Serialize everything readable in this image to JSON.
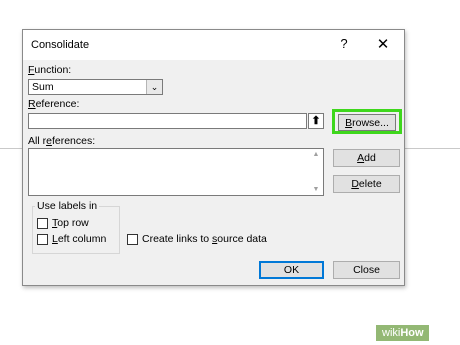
{
  "dialog": {
    "title": "Consolidate",
    "help_label": "?",
    "close_label": "✕",
    "function": {
      "label_pre": "",
      "label_underlined": "F",
      "label_post": "unction:",
      "value": "Sum"
    },
    "reference": {
      "label_underlined": "R",
      "label_post": "eference:",
      "value": "",
      "collapse_icon": "collapse-arrow-icon"
    },
    "browse_button": {
      "underlined": "B",
      "rest": "rowse..."
    },
    "all_references": {
      "pre": "All r",
      "underlined": "e",
      "post": "ferences:"
    },
    "add_button": {
      "underlined": "A",
      "rest": "dd"
    },
    "delete_button": {
      "underlined": "D",
      "rest": "elete"
    },
    "use_labels": {
      "legend": "Use labels in",
      "top_row": {
        "underlined": "T",
        "rest": "op row",
        "checked": false
      },
      "left_column": {
        "underlined": "L",
        "rest": "eft column",
        "checked": false
      }
    },
    "create_links": {
      "pre": "Create links to ",
      "underlined": "s",
      "post": "ource data",
      "checked": false
    },
    "ok_label": "OK",
    "close_button_label": "Close"
  },
  "watermark": {
    "part1": "wiki",
    "part2": "How"
  },
  "colors": {
    "highlight": "#3ed71c",
    "dialog_bg": "#f0f0f0",
    "watermark_bg": "#93b874"
  }
}
